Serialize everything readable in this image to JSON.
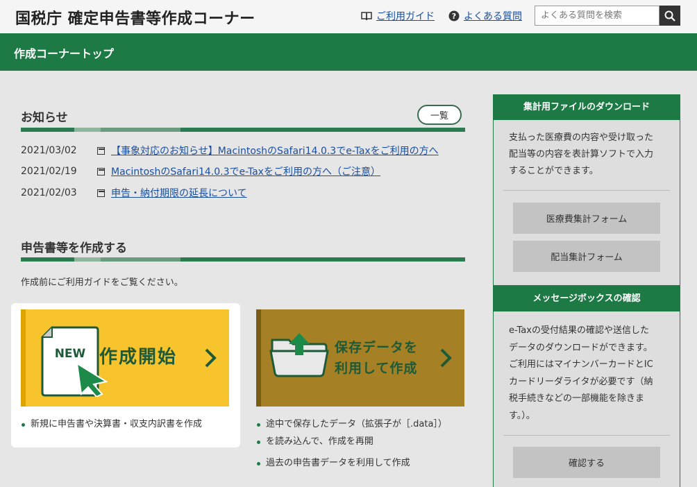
{
  "header": {
    "title": "国税庁 確定申告書等作成コーナー",
    "guide_link": "ご利用ガイド",
    "faq_link": "よくある質問",
    "search_placeholder": "よくある質問を検索"
  },
  "nav": {
    "title": "作成コーナートップ"
  },
  "notices": {
    "title": "お知らせ",
    "more_label": "一覧",
    "items": [
      {
        "date": "2021/03/02",
        "text": "【事象対応のお知らせ】MacintoshのSafari14.0.3でe-Taxをご利用の方へ"
      },
      {
        "date": "2021/02/19",
        "text": "MacintoshのSafari14.0.3でe-Taxをご利用の方へ（ご注意）"
      },
      {
        "date": "2021/02/03",
        "text": "申告・納付期限の延長について"
      }
    ]
  },
  "create": {
    "title": "申告書等を作成する",
    "note": "作成前にご利用ガイドをご覧ください。",
    "new_card": {
      "badge": "NEW",
      "label": "作成開始",
      "bullets": [
        "新規に申告書や決算書・収支内訳書を作成"
      ]
    },
    "load_card": {
      "label_line1": "保存データを",
      "label_line2": "利用して作成",
      "bullets": [
        "途中で保存したデータ（拡張子が［.data］）",
        "を読み込んで、作成を再開",
        "過去の申告書データを利用して作成"
      ]
    }
  },
  "sidebar": {
    "download": {
      "title": "集計用ファイルのダウンロード",
      "lines": [
        "支払った医療費の内容や受け取った",
        "配当等の内容を表計算ソフトで入力",
        "することができます。"
      ],
      "btn_medical": "医療費集計フォーム",
      "btn_dividend": "配当集計フォーム"
    },
    "messagebox": {
      "title": "メッセージボックスの確認",
      "lines": [
        "e-Taxの受付結果の確認や送信した",
        "データのダウンロードができます。",
        "ご利用にはマイナンバーカードとIC",
        "カードリーダライタが必要です（納",
        "税手続きなどの一部機能を除きま",
        "す。）。"
      ],
      "btn_confirm": "確認する"
    }
  },
  "colors": {
    "brand_green": "#1d7a44",
    "new_card": "#f8c42e",
    "load_card": "#a68024"
  }
}
